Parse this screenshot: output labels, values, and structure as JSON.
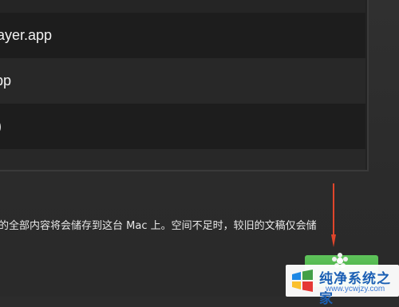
{
  "list": {
    "rows": [
      {
        "label": ""
      },
      {
        "label": "ayer.app"
      },
      {
        "label": "pp"
      },
      {
        "label": ")"
      }
    ]
  },
  "dialog": {
    "description": "的全部内容将会储存到这台 Mac 上。空间不足时，较旧的文稿仅会储"
  },
  "watermark": {
    "title": "纯净系统之家",
    "subtitle": "www.ycwjzy.com"
  },
  "colors": {
    "button": "#4cb748",
    "arrow": "#e0452b",
    "watermark_text": "#1a5fb4"
  }
}
